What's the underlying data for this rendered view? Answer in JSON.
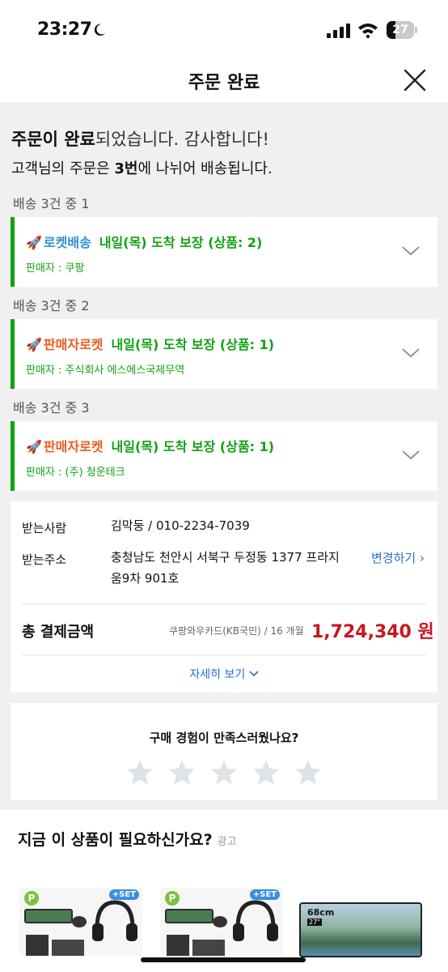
{
  "status": {
    "time": "23:27",
    "battery": "27"
  },
  "nav": {
    "title": "주문 완료"
  },
  "summary": {
    "headline_bold": "주문이 완료",
    "headline_rest": "되었습니다. 감사합니다!",
    "sub_pre": "고객님의 주문은 ",
    "sub_bold": "3번",
    "sub_post": "에 나뉘어 배송됩니다."
  },
  "shipments": [
    {
      "group_label": "배송 3건 중 1",
      "type": "로켓배송",
      "info": "내일(목) 도착 보장 (상품: 2)",
      "seller": "판매자 : 쿠팡",
      "type_color": "#2f8fd0"
    },
    {
      "group_label": "배송 3건 중 2",
      "type": "판매자로켓",
      "info": "내일(목) 도착 보장 (상품: 1)",
      "seller": "판매자 : 주식회사 에스에스국제무역",
      "type_color": "#ef5a1f"
    },
    {
      "group_label": "배송 3건 중 3",
      "type": "판매자로켓",
      "info": "내일(목) 도착 보장 (상품: 1)",
      "seller": "판매자 : (주) 청운테크",
      "type_color": "#ef5a1f"
    }
  ],
  "delivery": {
    "recipient_label": "받는사람",
    "recipient_value": "김막둥 / 010-2234-7039",
    "address_label": "받는주소",
    "address_line1": "충청남도 천안시 서북구 두정동 1377 프라지",
    "address_line2": "움9차 901호",
    "change_label": "변경하기",
    "total_label": "총 결제금액",
    "pay_method": "쿠팡와우카드(KB국민) / 16 개월",
    "total_amount": "1,724,340 원",
    "detail_label": "자세히 보기"
  },
  "rating": {
    "question": "구매 경험이 만족스러웠나요?",
    "stars": 5,
    "value": 0
  },
  "recommend": {
    "title": "지금 이 상품이 필요하신가요?",
    "ad_label": "광고",
    "products": [
      {
        "badge": "P",
        "set": "+SET"
      },
      {
        "badge": "P",
        "set": "+SET"
      },
      {
        "size": "68cm",
        "inch": "27\""
      }
    ]
  },
  "colors": {
    "accent_green": "#12a112",
    "price_red": "#c8161d",
    "link_blue": "#2a6fcf"
  }
}
